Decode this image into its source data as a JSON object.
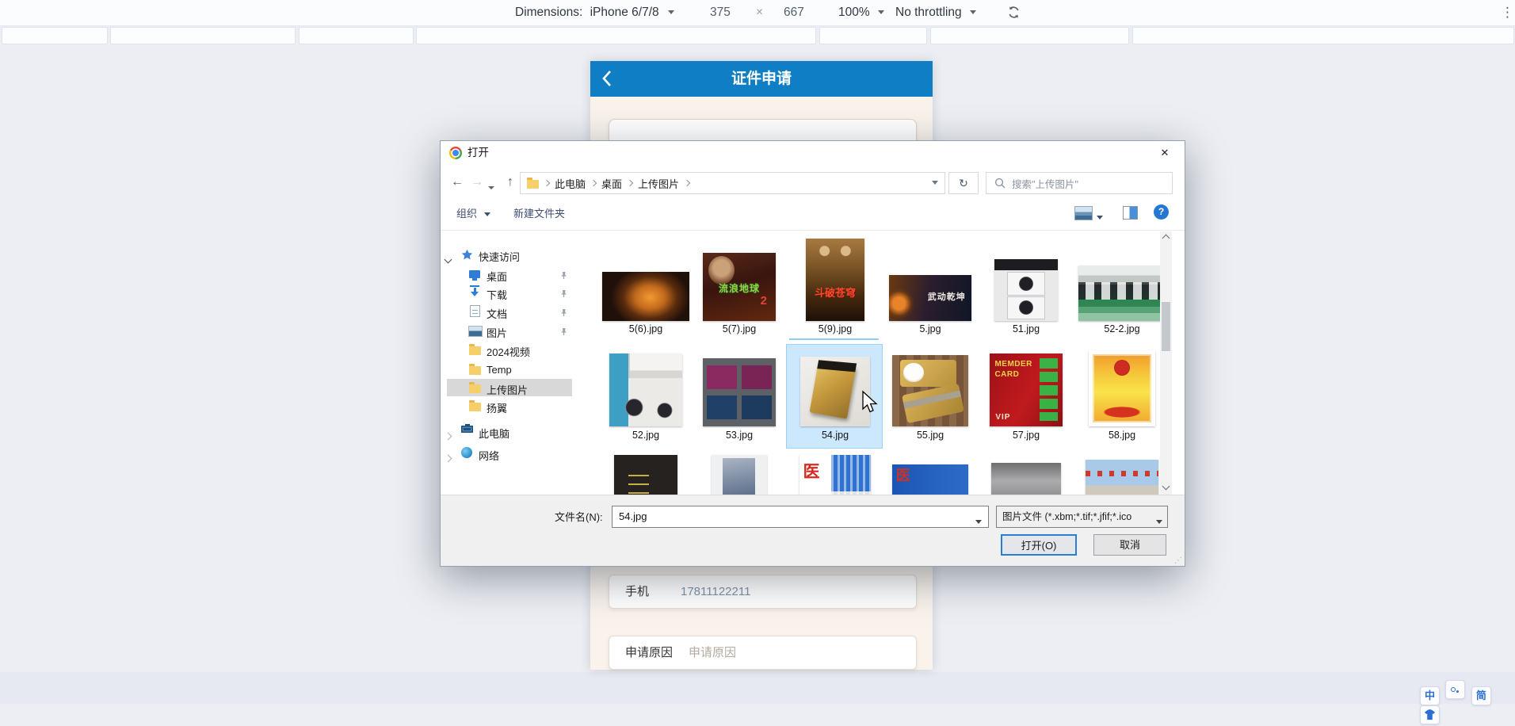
{
  "devtools": {
    "dimensions_label": "Dimensions:",
    "device": "iPhone 6/7/8",
    "viewport_width": "375",
    "times": "×",
    "viewport_height": "667",
    "zoom": "100%",
    "throttling": "No throttling"
  },
  "icons": {
    "back": "←",
    "forward": "→",
    "up": "↑",
    "refresh": "↻",
    "close": "✕",
    "help": "?",
    "menu": "⋮",
    "resize_grip": "⋰"
  },
  "page": {
    "header_title": "证件申请",
    "phone_label": "手机",
    "phone_value": "17811122211",
    "reason_label": "申请原因",
    "reason_placeholder": "申请原因"
  },
  "dialog": {
    "title": "打开",
    "breadcrumb": {
      "item1": "此电脑",
      "item2": "桌面",
      "item3": "上传图片"
    },
    "search_placeholder": "搜索\"上传图片\"",
    "organize_label": "组织",
    "new_folder_label": "新建文件夹",
    "sidebar": {
      "quick_access": "快速访问",
      "desktop": "桌面",
      "downloads": "下载",
      "documents": "文档",
      "pictures": "图片",
      "videos2024": "2024视频",
      "temp": "Temp",
      "upload_images": "上传图片",
      "yangyi": "扬翼",
      "this_pc": "此电脑",
      "network": "网络"
    },
    "files": {
      "f1": "5(6).jpg",
      "f2": "5(7).jpg",
      "f3": "5(9).jpg",
      "f4": "5.jpg",
      "f5": "51.jpg",
      "f6": "52-2.jpg",
      "f7": "52.jpg",
      "f8": "53.jpg",
      "f9": "54.jpg",
      "f10": "55.jpg",
      "f11": "57.jpg",
      "f12": "58.jpg"
    },
    "thumb_text": {
      "wandering_earth": "流浪地球",
      "wandering_earth_num": "2",
      "doupo": "斗破苍穹",
      "wudong": "武动乾坤",
      "memder": "MEMDER",
      "card": "CARD",
      "vip": "VIP",
      "yi": "医"
    },
    "footer": {
      "filename_label": "文件名(N):",
      "filename_value": "54.jpg",
      "filetype_value": "图片文件 (*.xbm;*.tif;*.jfif;*.ico",
      "open_label": "打开(O)",
      "cancel_label": "取消"
    }
  },
  "ime": {
    "chinese": "中",
    "simplified": "简"
  }
}
